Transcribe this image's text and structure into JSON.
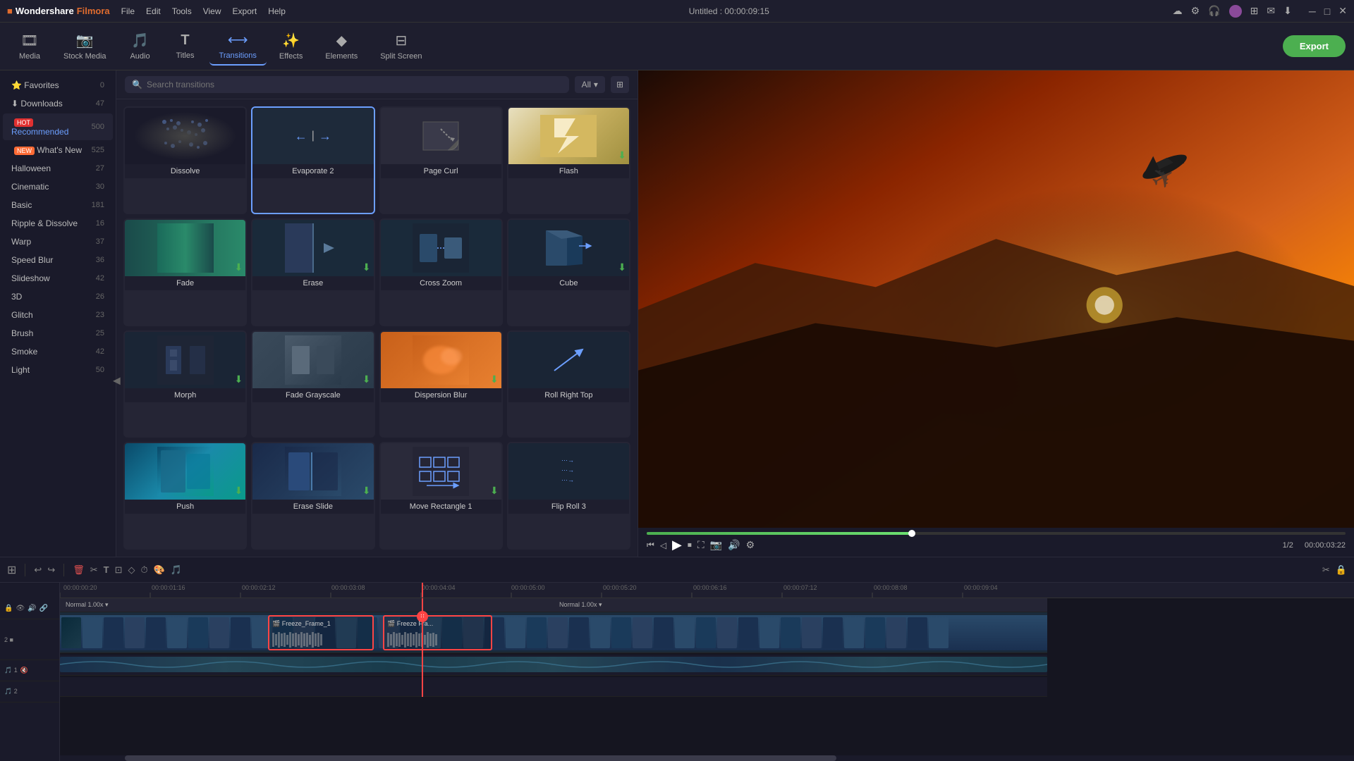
{
  "app": {
    "name": "Wondershare",
    "product": "Filmora",
    "title": "Untitled : 00:00:09:15",
    "window_controls": [
      "minimize",
      "maximize",
      "close"
    ]
  },
  "topbar": {
    "menu_items": [
      "File",
      "Edit",
      "Tools",
      "View",
      "Export",
      "Help"
    ],
    "icons": [
      "cloud-icon",
      "settings-icon",
      "headphones-icon",
      "avatar-icon",
      "grid-icon",
      "mail-icon",
      "download-icon"
    ]
  },
  "main_toolbar": {
    "items": [
      {
        "id": "media",
        "label": "Media",
        "icon": "🎞"
      },
      {
        "id": "stock_media",
        "label": "Stock Media",
        "icon": "📷"
      },
      {
        "id": "audio",
        "label": "Audio",
        "icon": "🎵"
      },
      {
        "id": "titles",
        "label": "Titles",
        "icon": "T"
      },
      {
        "id": "transitions",
        "label": "Transitions",
        "icon": "⟷",
        "active": true
      },
      {
        "id": "effects",
        "label": "Effects",
        "icon": "✨"
      },
      {
        "id": "elements",
        "label": "Elements",
        "icon": "◆"
      },
      {
        "id": "split_screen",
        "label": "Split Screen",
        "icon": "⊟"
      }
    ],
    "export_label": "Export"
  },
  "sidebar": {
    "items": [
      {
        "id": "favorites",
        "label": "Favorites",
        "count": "0",
        "icon": "⭐"
      },
      {
        "id": "downloads",
        "label": "Downloads",
        "count": "47",
        "icon": "⬇"
      },
      {
        "id": "recommended",
        "label": "Recommended",
        "count": "500",
        "badge": "HOT",
        "icon": "🔥",
        "active": true
      },
      {
        "id": "whats_new",
        "label": "What's New",
        "count": "525",
        "badge": "NEW"
      },
      {
        "id": "halloween",
        "label": "Halloween",
        "count": "27"
      },
      {
        "id": "cinematic",
        "label": "Cinematic",
        "count": "30"
      },
      {
        "id": "basic",
        "label": "Basic",
        "count": "181"
      },
      {
        "id": "ripple_dissolve",
        "label": "Ripple & Dissolve",
        "count": "16"
      },
      {
        "id": "warp",
        "label": "Warp",
        "count": "37"
      },
      {
        "id": "speed_blur",
        "label": "Speed Blur",
        "count": "36"
      },
      {
        "id": "slideshow",
        "label": "Slideshow",
        "count": "42"
      },
      {
        "id": "3d",
        "label": "3D",
        "count": "26"
      },
      {
        "id": "glitch",
        "label": "Glitch",
        "count": "23"
      },
      {
        "id": "brush",
        "label": "Brush",
        "count": "25"
      },
      {
        "id": "smoke",
        "label": "Smoke",
        "count": "42"
      },
      {
        "id": "light",
        "label": "Light",
        "count": "50"
      }
    ]
  },
  "transitions_panel": {
    "search_placeholder": "Search transitions",
    "filter_label": "All",
    "items": [
      {
        "id": "dissolve",
        "label": "Dissolve",
        "thumb_type": "dissolve",
        "downloaded": true
      },
      {
        "id": "evaporate2",
        "label": "Evaporate 2",
        "thumb_type": "evaporate",
        "selected": true,
        "downloaded": true
      },
      {
        "id": "page_curl",
        "label": "Page Curl",
        "thumb_type": "pagecurl",
        "downloaded": false
      },
      {
        "id": "flash",
        "label": "Flash",
        "thumb_type": "flash",
        "downloaded": true
      },
      {
        "id": "fade",
        "label": "Fade",
        "thumb_type": "fade",
        "downloaded": true
      },
      {
        "id": "erase",
        "label": "Erase",
        "thumb_type": "erase",
        "downloaded": true
      },
      {
        "id": "cross_zoom",
        "label": "Cross Zoom",
        "thumb_type": "crosszoom",
        "downloaded": false
      },
      {
        "id": "cube",
        "label": "Cube",
        "thumb_type": "cube",
        "downloaded": true
      },
      {
        "id": "morph",
        "label": "Morph",
        "thumb_type": "morph",
        "downloaded": true
      },
      {
        "id": "fade_grayscale",
        "label": "Fade Grayscale",
        "thumb_type": "fadegrayscale",
        "downloaded": true
      },
      {
        "id": "dispersion_blur",
        "label": "Dispersion Blur",
        "thumb_type": "dispersionblur",
        "downloaded": true
      },
      {
        "id": "roll_right_top",
        "label": "Roll Right Top",
        "thumb_type": "rollrighttop",
        "downloaded": false
      },
      {
        "id": "push",
        "label": "Push",
        "thumb_type": "push",
        "downloaded": true
      },
      {
        "id": "erase_slide",
        "label": "Erase Slide",
        "thumb_type": "eraseslide",
        "downloaded": true
      },
      {
        "id": "move_rectangle1",
        "label": "Move Rectangle 1",
        "thumb_type": "moverectangle",
        "downloaded": true
      },
      {
        "id": "flip_roll3",
        "label": "Flip Roll 3",
        "thumb_type": "fliproll3",
        "downloaded": false
      }
    ]
  },
  "preview": {
    "timecode": "00:00:03:22",
    "total_frames": "1/2",
    "progress_percent": 38
  },
  "timeline": {
    "ruler_times": [
      "00:00:00:20",
      "00:00:01:16",
      "00:00:02:12",
      "00:00:03:08",
      "00:00:04:04",
      "00:00:05:00",
      "00:00:05:20",
      "00:00:06:16",
      "00:00:07:12",
      "00:00:08:08",
      "00:00:09:04"
    ],
    "playhead_time": "00:00:04:04",
    "tracks": [
      {
        "id": "video1",
        "type": "video",
        "speed": "Normal 1.00x",
        "clips": [
          {
            "id": "clip1",
            "label": "🎬 Freeze_Frame_1",
            "selected": true,
            "start_pct": 27,
            "width_pct": 10
          },
          {
            "id": "clip2",
            "label": "🎬 Freeze Fra...",
            "selected": true,
            "start_pct": 41,
            "width_pct": 11
          }
        ]
      },
      {
        "id": "audio1",
        "type": "audio"
      }
    ]
  }
}
